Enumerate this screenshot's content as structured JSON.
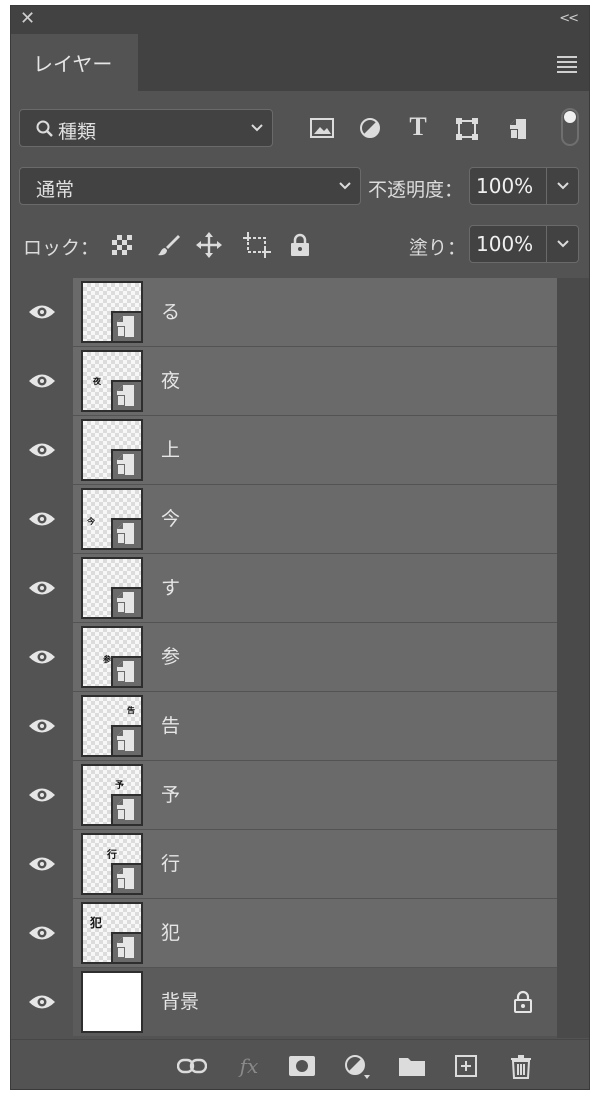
{
  "panel": {
    "tab_label": "レイヤー"
  },
  "window": {
    "collapse_label": "<<"
  },
  "filter": {
    "kind_label": "種類",
    "icons": [
      "image-filter-icon",
      "adjustment-filter-icon",
      "type-filter-icon",
      "shape-filter-icon",
      "smart-object-filter-icon",
      "filter-toggle-icon"
    ]
  },
  "blend": {
    "mode": "通常",
    "opacity_label": "不透明度：",
    "opacity_value": "100%"
  },
  "lock": {
    "label": "ロック：",
    "icons": [
      "lock-transparent-icon",
      "lock-image-icon",
      "lock-position-icon",
      "lock-artboard-icon",
      "lock-all-icon"
    ],
    "fill_label": "塗り：",
    "fill_value": "100%"
  },
  "layers": [
    {
      "name": "る",
      "thumb_glyph": "",
      "visible": true
    },
    {
      "name": "夜",
      "thumb_glyph": "夜",
      "visible": true
    },
    {
      "name": "上",
      "thumb_glyph": "",
      "visible": true
    },
    {
      "name": "今",
      "thumb_glyph": "今",
      "visible": true
    },
    {
      "name": "す",
      "thumb_glyph": "",
      "visible": true
    },
    {
      "name": "参",
      "thumb_glyph": "参",
      "visible": true
    },
    {
      "name": "告",
      "thumb_glyph": "告",
      "visible": true
    },
    {
      "name": "予",
      "thumb_glyph": "予",
      "visible": true
    },
    {
      "name": "行",
      "thumb_glyph": "行",
      "visible": true
    },
    {
      "name": "犯",
      "thumb_glyph": "犯",
      "visible": true
    },
    {
      "name": "背景",
      "thumb_glyph": "",
      "visible": true,
      "locked": true,
      "background": true
    }
  ],
  "footer": {
    "icons": [
      "link-layers-icon",
      "fx-icon",
      "add-mask-icon",
      "new-adjustment-icon",
      "new-group-icon",
      "new-layer-icon",
      "delete-icon"
    ],
    "fx_label": "fx"
  },
  "colors": {
    "panel": "#535353",
    "layer_row": "#6a6a6a",
    "header": "#424242"
  }
}
